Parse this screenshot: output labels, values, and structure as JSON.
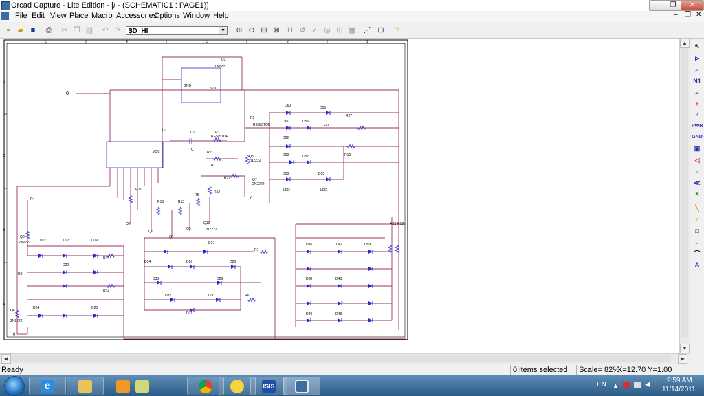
{
  "window": {
    "title": "Orcad Capture - Lite Edition - [/ - (SCHEMATIC1 : PAGE1)]",
    "controls": {
      "minimize": "–",
      "maximize": "❐",
      "close": "✕"
    },
    "doc_controls": {
      "minimize": "–",
      "restore": "❐",
      "close": "✕"
    }
  },
  "menu": [
    "File",
    "Edit",
    "View",
    "Place",
    "Macro",
    "Accessories",
    "Options",
    "Window",
    "Help"
  ],
  "toolbar": {
    "part_value": "$D_HI"
  },
  "schematic": {
    "border_columns": [
      "5",
      "4",
      "3",
      "2",
      "1"
    ],
    "border_rows": [
      "D",
      "C",
      "B",
      "A"
    ],
    "labels": {
      "u3": "U3",
      "lm555": "LM555",
      "u1": "U1",
      "c1": "C1",
      "c": "C",
      "r1": "R1",
      "resistor1": "RESISTOR",
      "r2": "R2",
      "resistor2": "RESISTOR",
      "zero_top": "0",
      "r21": "R21",
      "r": "R",
      "q8": "Q8",
      "q8_type": "2N2222",
      "r17": "R17",
      "q7": "Q7",
      "q7_type": "2N2222",
      "zero_mid": "0",
      "r10": "R10",
      "r27": "R27",
      "d60": "D60",
      "d55": "D55",
      "d61": "D61",
      "d56": "D56",
      "d62": "D62",
      "d57": "D57",
      "d63": "D63",
      "d58": "D58",
      "d53": "D53",
      "led": "LED",
      "r4": "R4",
      "q3": "Q3",
      "q3_type": "2N2222",
      "r11": "R11",
      "r15": "R15",
      "r13": "R13",
      "r5": "R5",
      "r12": "R12",
      "q2": "Q2",
      "q6": "Q6",
      "q1": "Q1",
      "q5": "Q5",
      "q10": "Q10",
      "q_type": "2N2222",
      "d17": "D17",
      "d18": "D18",
      "d19": "D19",
      "d20": "D20",
      "r23": "R23",
      "r24": "R24",
      "r9": "R9",
      "d24": "D24",
      "d25": "D25",
      "q4": "Q4",
      "q4_type": "2N2222",
      "zero_bot": "0",
      "d27": "D27",
      "d34": "D34",
      "d26": "D26",
      "d28": "D28",
      "d33": "D33",
      "d29": "D29",
      "d32": "D32",
      "d30": "D30",
      "d31": "D31",
      "r7": "R7",
      "r6": "R6",
      "d36": "D36",
      "d41": "D41",
      "d59": "D59",
      "d43": "D43",
      "d40": "D40",
      "d48": "D48",
      "d38": "D38",
      "r22": "R22",
      "r18": "R18"
    }
  },
  "status": {
    "ready": "Ready",
    "selected": "0 items selected",
    "scale": "Scale= 82%",
    "coords": "X=12.70  Y=1.00"
  },
  "taskbar": {
    "apps": [
      "windows-explorer",
      "internet-explorer",
      "file-explorer",
      "media-player",
      "documents",
      "chrome",
      "yahoo-messenger",
      "isis",
      "orcad-capture"
    ],
    "lang": "EN",
    "time": "9:59 AM",
    "date": "11/14/2011"
  },
  "colors": {
    "wire": "#993366",
    "part": "#2a2ad0",
    "pin": "#cc3333",
    "text": "#000000",
    "accent": "#2b5a85"
  }
}
